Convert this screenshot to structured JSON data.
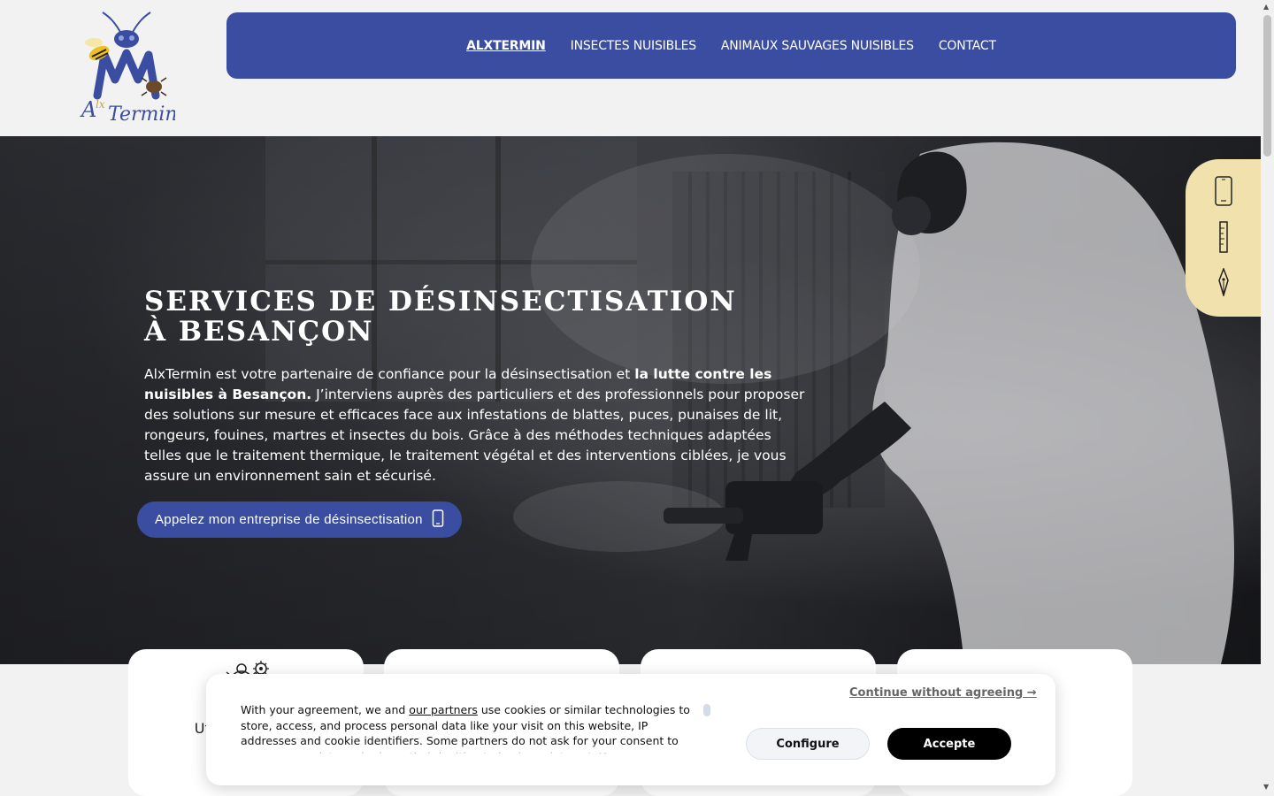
{
  "brand": {
    "logo_text": "AlxTermin"
  },
  "nav": {
    "items": [
      {
        "label": "ALXTERMIN",
        "active": true
      },
      {
        "label": "INSECTES NUISIBLES",
        "active": false
      },
      {
        "label": "ANIMAUX SAUVAGES NUISIBLES",
        "active": false
      },
      {
        "label": "CONTACT",
        "active": false
      }
    ]
  },
  "hero": {
    "title": "SERVICES DE DÉSINSECTISATION À BESANÇON",
    "text_part1": "AlxTermin est votre partenaire de confiance pour la désinsectisation et ",
    "text_bold": "la lutte contre les nuisibles à Besançon.",
    "text_part2": " J’interviens auprès des particuliers et des professionnels pour proposer des solutions sur mesure et efficaces face aux infestations de blattes, puces, punaises de lit, rongeurs, fouines, martres et insectes du bois. Grâce à des méthodes techniques adaptées telles que le traitement thermique, le traitement végétal et des interventions ciblées, je vous assure un environnement sain et sécurisé.",
    "cta_label": "Appelez mon entreprise de désinsectisation",
    "cta_icon": "phone-icon"
  },
  "side_widget": {
    "icons": [
      "phone-icon",
      "ruler-icon",
      "pen-nib-icon"
    ]
  },
  "cards": [
    {
      "icon": "bug-gear-icon",
      "text": "Utilisati chir re"
    },
    {
      "icon": "",
      "text": ""
    },
    {
      "icon": "",
      "text": ""
    },
    {
      "icon": "",
      "text": ""
    }
  ],
  "cookie": {
    "text_before_link": "With your agreement, we and ",
    "link": "our partners",
    "text_after_link": " use cookies or similar technologies to store, access, and process personal data like your visit on this website, IP addresses and cookie identifiers. Some partners do not ask for your consent to process your data and rely on their legitimate business interest. You can",
    "continue_label": "Continue without agreeing →",
    "configure_label": "Configure",
    "accept_label": "Accepte"
  },
  "colors": {
    "nav_bg": "#3a4da0",
    "side_widget_bg": "#f1e2ad",
    "page_bg": "#f2f2f2"
  }
}
